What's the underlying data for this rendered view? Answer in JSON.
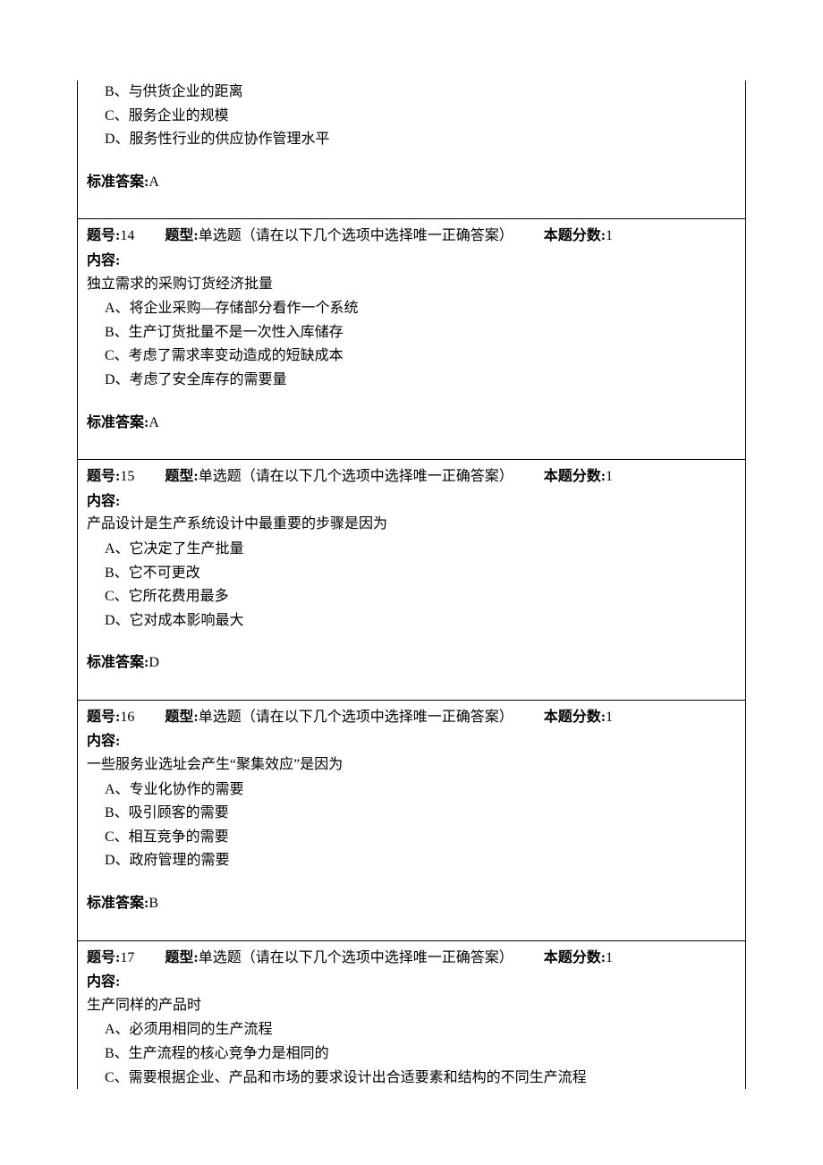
{
  "labels": {
    "question_no": "题号:",
    "question_type": "题型:",
    "question_score": "本题分数:",
    "content": "内容:",
    "answer": "标准答案:"
  },
  "type_text": "单选题（请在以下几个选项中选择唯一正确答案）",
  "q13_tail": {
    "options": [
      "B、与供货企业的距离",
      "C、服务企业的规模",
      "D、服务性行业的供应协作管理水平"
    ],
    "answer": "A"
  },
  "q14": {
    "no": "14",
    "score": "1",
    "prompt": "独立需求的采购订货经济批量",
    "options": [
      "A、将企业采购—存储部分看作一个系统",
      "B、生产订货批量不是一次性入库储存",
      "C、考虑了需求率变动造成的短缺成本",
      "D、考虑了安全库存的需要量"
    ],
    "answer": "A"
  },
  "q15": {
    "no": "15",
    "score": "1",
    "prompt": "产品设计是生产系统设计中最重要的步骤是因为",
    "options": [
      "A、它决定了生产批量",
      "B、它不可更改",
      "C、它所花费用最多",
      "D、它对成本影响最大"
    ],
    "answer": "D"
  },
  "q16": {
    "no": "16",
    "score": "1",
    "prompt": "一些服务业选址会产生“聚集效应”是因为",
    "options": [
      "A、专业化协作的需要",
      "B、吸引顾客的需要",
      "C、相互竞争的需要",
      "D、政府管理的需要"
    ],
    "answer": "B"
  },
  "q17": {
    "no": "17",
    "score": "1",
    "prompt": "生产同样的产品时",
    "options": [
      "A、必须用相同的生产流程",
      "B、生产流程的核心竞争力是相同的",
      "C、需要根据企业、产品和市场的要求设计出合适要素和结构的不同生产流程"
    ]
  }
}
